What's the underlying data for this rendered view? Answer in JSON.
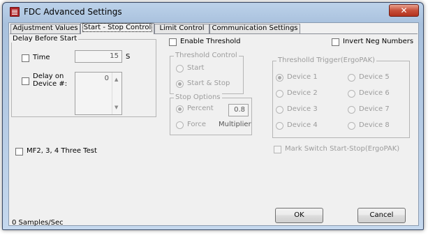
{
  "window": {
    "title": "FDC Advanced Settings",
    "close_glyph": "✕"
  },
  "tabs": [
    {
      "label": "Adjustment Values",
      "active": false
    },
    {
      "label": "Start - Stop Control",
      "active": true
    },
    {
      "label": "Limit Control",
      "active": false
    },
    {
      "label": "Communication Settings",
      "active": false
    }
  ],
  "delay_before_start": {
    "group_label": "Delay Before Start",
    "time_label": "Time",
    "time_value": "15",
    "time_unit": "S",
    "delay_on_device_label_1": "Delay on",
    "delay_on_device_label_2": "Device #:",
    "device_value": "0"
  },
  "enable_threshold_label": "Enable Threshold",
  "invert_neg_label": "Invert Neg Numbers",
  "threshold_control": {
    "group_label": "Threshold Control",
    "start_label": "Start",
    "start_stop_label": "Start & Stop",
    "selected": "Start & Stop"
  },
  "stop_options": {
    "group_label": "Stop Options",
    "percent_label": "Percent",
    "force_label": "Force",
    "multiplier_label": "Multiplier",
    "value": "0.8",
    "selected": "Percent"
  },
  "threshold_trigger": {
    "group_label": "Thresholld Trigger(ErgoPAK)",
    "devices": [
      "Device 1",
      "Device 5",
      "Device 2",
      "Device 6",
      "Device 3",
      "Device 7",
      "Device 4",
      "Device 8"
    ],
    "selected": "Device 1"
  },
  "mark_switch_label": "Mark Switch Start-Stop(ErgoPAK)",
  "mf2_label": "MF2, 3, 4 Three Test",
  "status_text": "0 Samples/Sec",
  "buttons": {
    "ok": "OK",
    "cancel": "Cancel"
  },
  "colors": {
    "title_bar": "#a9c1dd",
    "close_button": "#c7503a",
    "dialog_face": "#f0f0f0",
    "disabled_text": "#9c9c9c"
  }
}
